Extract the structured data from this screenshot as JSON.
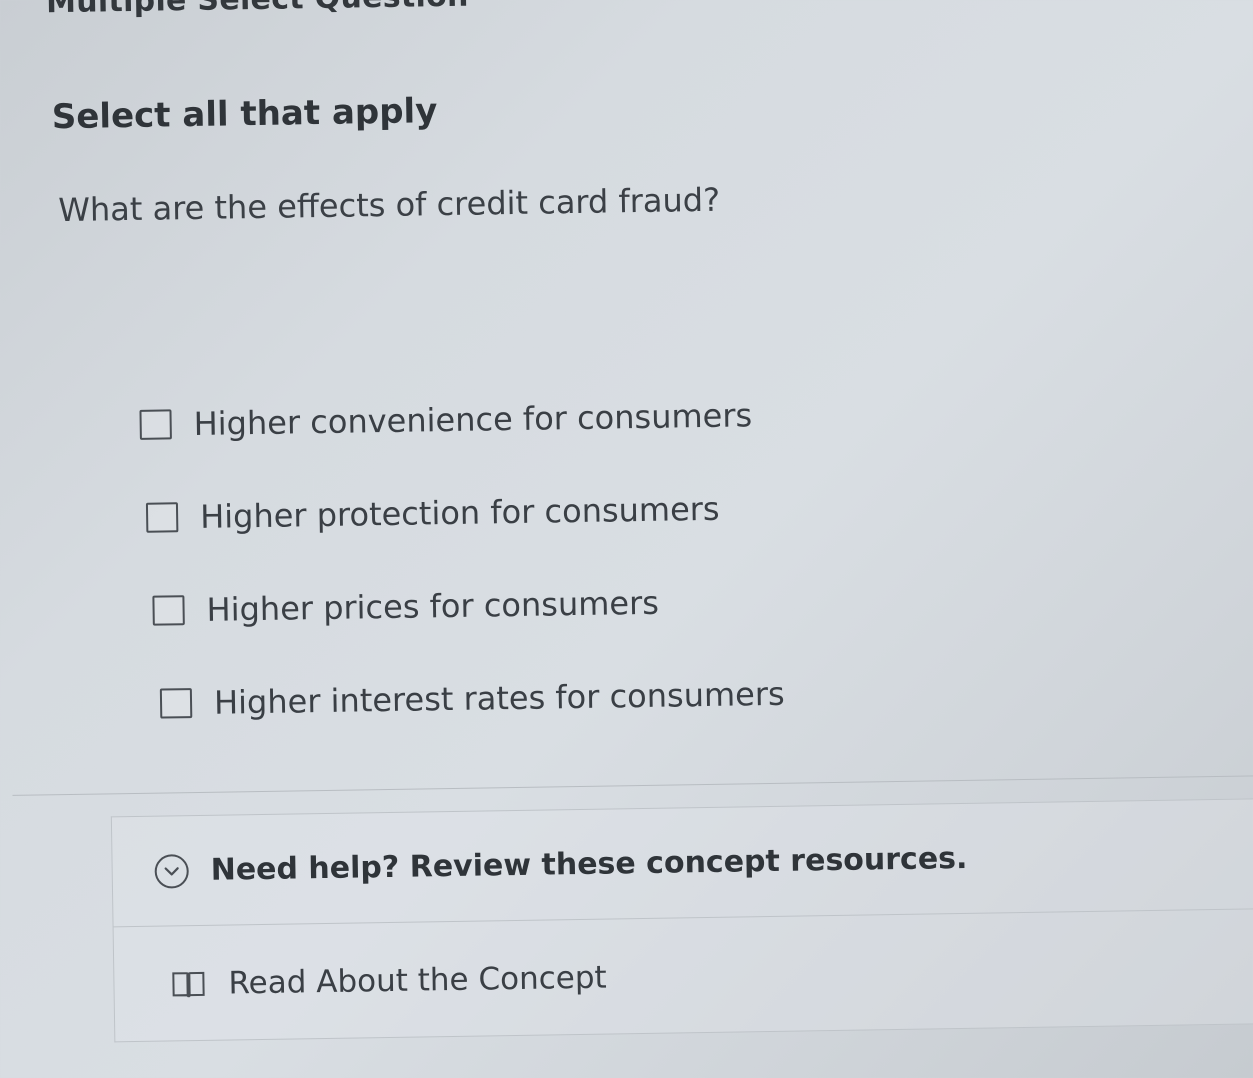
{
  "header": {
    "question_type": "Multiple Select Question"
  },
  "question": {
    "instruction": "Select all that apply",
    "prompt": "What are the effects of credit card fraud?"
  },
  "options": [
    {
      "label": "Higher convenience for consumers",
      "checked": false
    },
    {
      "label": "Higher protection for consumers",
      "checked": false
    },
    {
      "label": "Higher prices for consumers",
      "checked": false
    },
    {
      "label": "Higher interest rates for consumers",
      "checked": false
    }
  ],
  "help": {
    "title": "Need help? Review these concept resources.",
    "icon": "chevron-down-icon",
    "resources": [
      {
        "label": "Read About the Concept",
        "icon": "book-icon"
      }
    ]
  }
}
